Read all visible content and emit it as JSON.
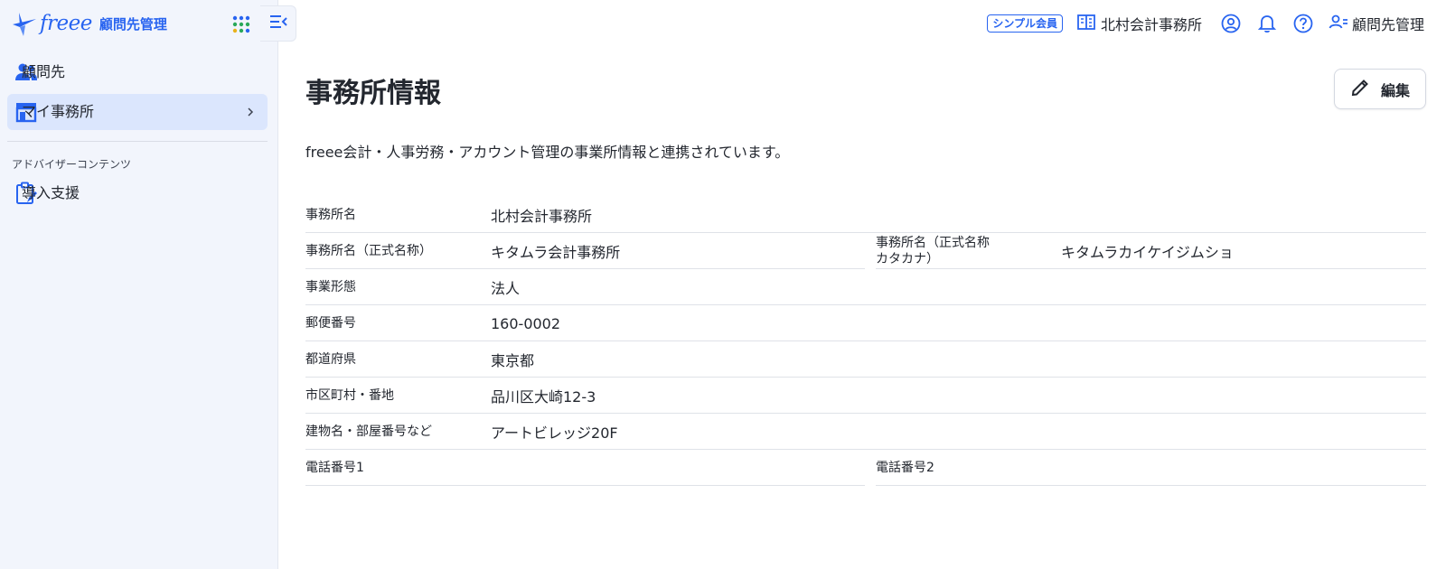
{
  "sidebar": {
    "brand_word": "freee",
    "brand_sub": "顧問先管理",
    "items": [
      {
        "label": "顧問先",
        "icon": "users-icon"
      },
      {
        "label": "マイ事務所",
        "icon": "storefront-icon",
        "active": true
      }
    ],
    "section_title": "アドバイザーコンテンツ",
    "section_items": [
      {
        "label": "導入支援",
        "icon": "clipboard-edit-icon"
      }
    ]
  },
  "header": {
    "plan_badge": "シンプル会員",
    "office_name": "北村会計事務所",
    "user_label": "顧問先管理"
  },
  "main": {
    "title": "事務所情報",
    "edit_label": "編集",
    "description": "freee会計・人事労務・アカウント管理の事業所情報と連携されています。",
    "fields": {
      "office_name": {
        "label": "事務所名",
        "value": "北村会計事務所"
      },
      "official_name": {
        "label": "事務所名（正式名称）",
        "value": "キタムラ会計事務所"
      },
      "official_kana": {
        "label": "事務所名（正式名称\nカタカナ）",
        "value": "キタムラカイケイジムショ"
      },
      "business_type": {
        "label": "事業形態",
        "value": "法人"
      },
      "postal_code": {
        "label": "郵便番号",
        "value": "160-0002"
      },
      "prefecture": {
        "label": "都道府県",
        "value": "東京都"
      },
      "city_address": {
        "label": "市区町村・番地",
        "value": "品川区大崎12-3"
      },
      "building": {
        "label": "建物名・部屋番号など",
        "value": "アートビレッジ20F"
      },
      "phone1": {
        "label": "電話番号1",
        "value": ""
      },
      "phone2": {
        "label": "電話番号2",
        "value": ""
      }
    }
  },
  "colors": {
    "accent": "#2864f0",
    "sidebar_bg": "#f2f5fc",
    "active_bg": "#dbe6fd",
    "text": "#23272f"
  }
}
